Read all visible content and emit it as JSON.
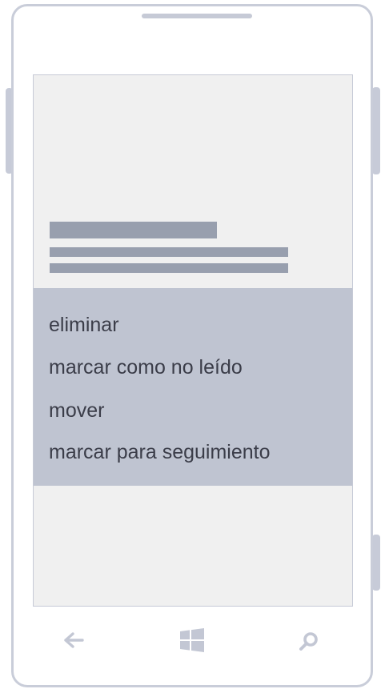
{
  "context_menu": {
    "items": [
      {
        "label": "eliminar"
      },
      {
        "label": "marcar como no leído"
      },
      {
        "label": "mover"
      },
      {
        "label": "marcar para seguimiento"
      }
    ]
  },
  "nav_bar": {
    "back_icon": "back-arrow-icon",
    "start_icon": "windows-logo-icon",
    "search_icon": "search-icon"
  },
  "colors": {
    "device_frame": "#c9cdd9",
    "screen_background": "#f0f0f0",
    "placeholder_bar": "#989fae",
    "menu_background": "#bfc4d1",
    "menu_text": "#3b3d49",
    "nav_icon": "#c3c7d4"
  }
}
